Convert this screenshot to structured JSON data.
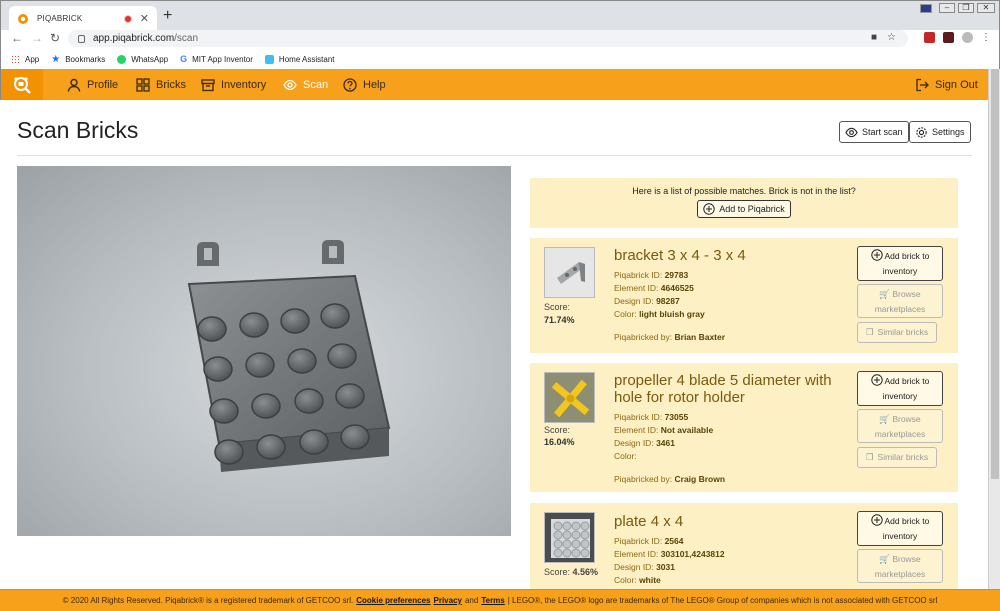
{
  "browser": {
    "tab_title": "PIQABRICK",
    "new_tab": "+",
    "url_host": "app.piqabrick.com",
    "url_path": "/scan",
    "bookmarks": [
      {
        "label": "App",
        "icon": "apps-grid-icon",
        "color": "#e8453c"
      },
      {
        "label": "Bookmarks",
        "icon": "star-icon",
        "color": "#1a73e8"
      },
      {
        "label": "WhatsApp",
        "icon": "whatsapp-icon",
        "color": "#25d366"
      },
      {
        "label": "MIT App Inventor",
        "icon": "google-icon",
        "color": "#4285f4"
      },
      {
        "label": "Home Assistant",
        "icon": "home-assistant-icon",
        "color": "#41bdf5"
      }
    ]
  },
  "nav": {
    "items": [
      {
        "label": "Profile",
        "icon": "user-icon"
      },
      {
        "label": "Bricks",
        "icon": "grid-icon"
      },
      {
        "label": "Inventory",
        "icon": "box-icon"
      },
      {
        "label": "Scan",
        "icon": "eye-icon"
      },
      {
        "label": "Help",
        "icon": "help-icon"
      }
    ],
    "sign_out": "Sign Out",
    "accent": "#f7a01b",
    "active_color": "#ffffff"
  },
  "page": {
    "title": "Scan Bricks",
    "start_scan": "Start scan",
    "settings": "Settings"
  },
  "notice": {
    "text": "Here is a list of possible matches. Brick is not in the list?",
    "add_button": "Add to Piqabrick"
  },
  "labels": {
    "score": "Score:",
    "piqabrick_id": "Piqabrick ID:",
    "element_id": "Element ID:",
    "design_id": "Design ID:",
    "color": "Color:",
    "piqabricked_by": "Piqabricked by:",
    "add_brick_1": "Add brick to",
    "add_brick_2": "inventory",
    "browse_1": "Browse",
    "browse_2": "marketplaces",
    "similar": "Similar bricks"
  },
  "results": [
    {
      "name": "bracket 3 x 4 - 3 x 4",
      "score": "71.74%",
      "piqabrick_id": "29783",
      "element_id": "4646525",
      "design_id": "98287",
      "color": "light bluish gray",
      "piqabricked_by": "Brian Baxter"
    },
    {
      "name": "propeller 4 blade 5 diameter with hole for rotor holder",
      "score": "16.04%",
      "piqabrick_id": "73055",
      "element_id": "Not available",
      "design_id": "3461",
      "color": "",
      "piqabricked_by": "Craig Brown"
    },
    {
      "name": "plate 4 x 4",
      "score": "4.56%",
      "piqabrick_id": "2564",
      "element_id": "303101,4243812",
      "design_id": "3031",
      "color": "white"
    }
  ],
  "footer": {
    "text1": "© 2020 All Rights Reserved. Piqabrick® is a registered trademark of GETCOO srl.",
    "cookie": "Cookie preferences",
    "privacy": "Privacy",
    "and": "and",
    "terms": "Terms",
    "text2": "| LEGO®, the LEGO® logo are trademarks of The LEGO® Group of companies which is not associated with GETCOO srl"
  }
}
